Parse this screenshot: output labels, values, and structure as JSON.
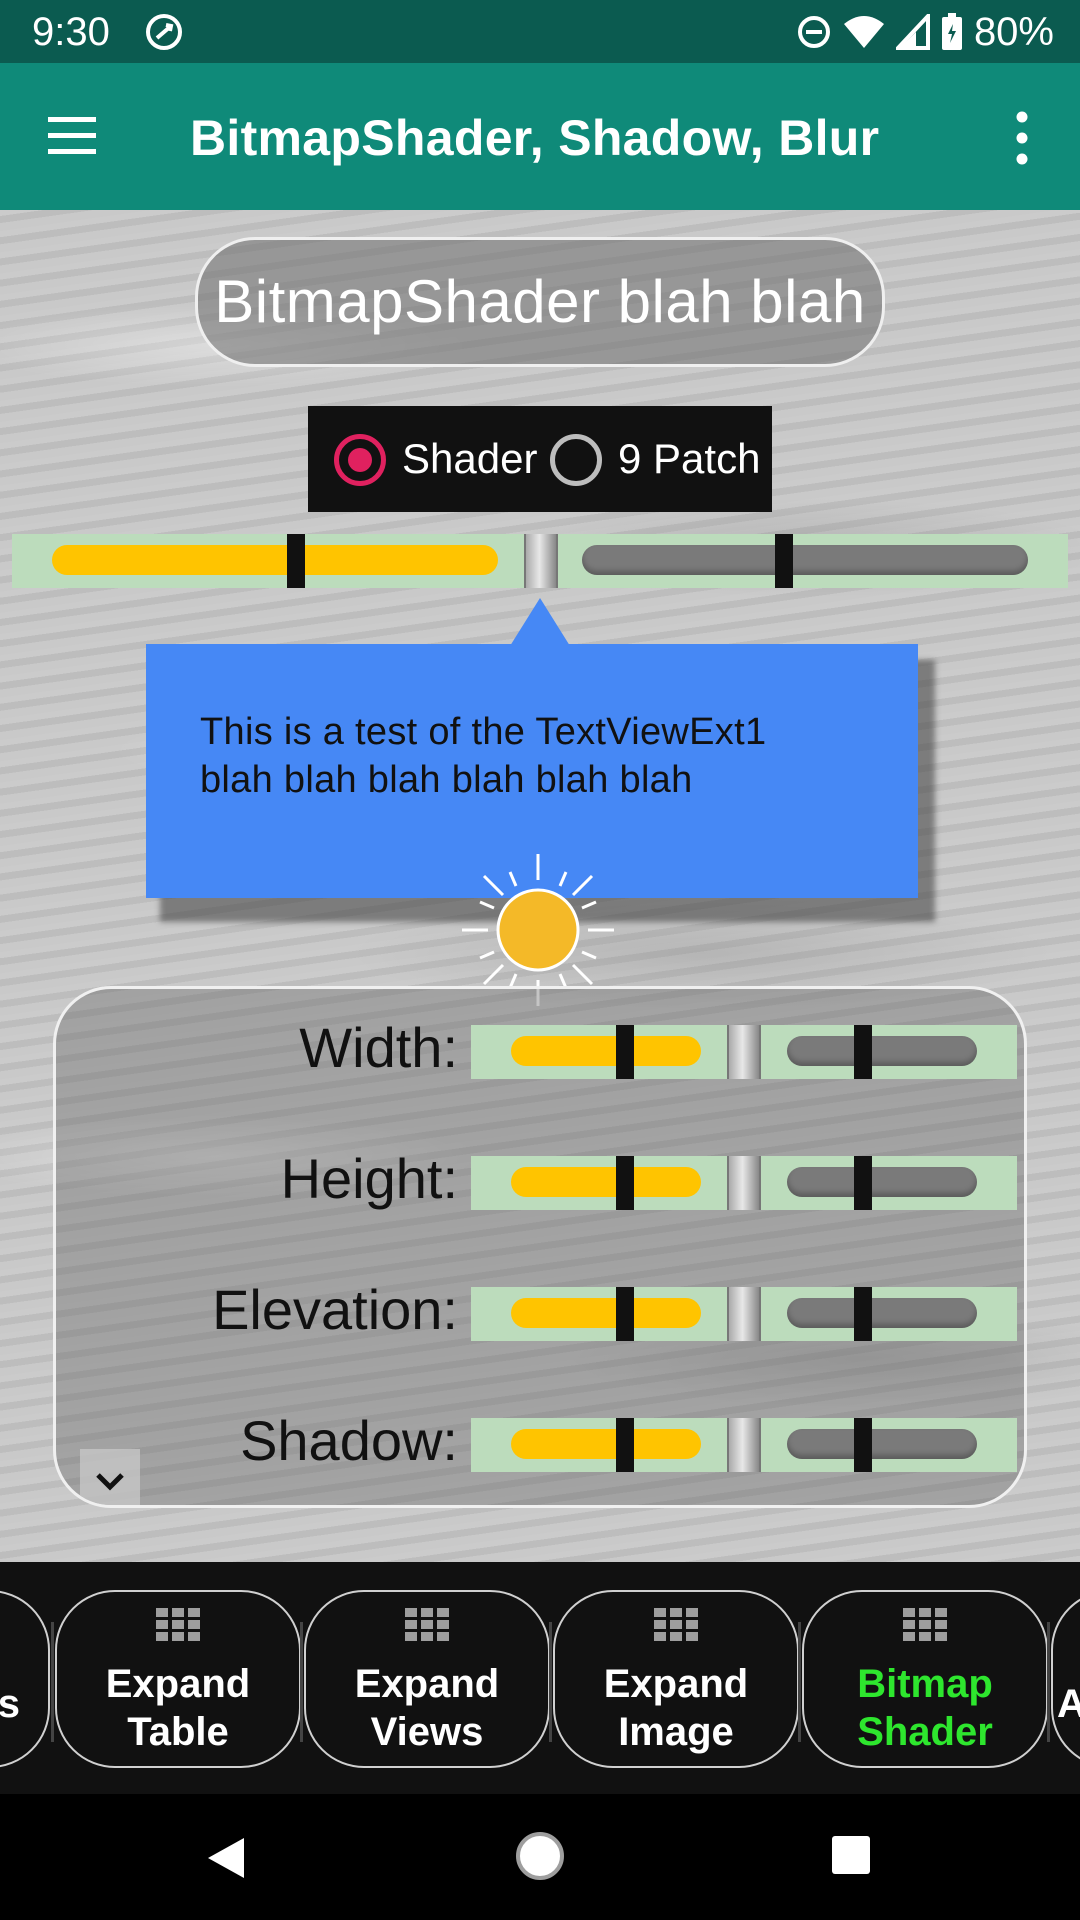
{
  "status_bar": {
    "time": "9:30",
    "battery_text": "80%"
  },
  "toolbar": {
    "title": "BitmapShader, Shadow, Blur"
  },
  "header_pill": {
    "text": "BitmapShader blah blah"
  },
  "radio_group": {
    "options": [
      {
        "label": "Shader",
        "selected": true
      },
      {
        "label": "9 Patch",
        "selected": false
      }
    ]
  },
  "main_slider": {
    "progress": 0.5
  },
  "callout": {
    "line1": "This is a test of the TextViewExt1",
    "line2": "blah blah blah blah blah blah"
  },
  "controls": {
    "rows": [
      {
        "label": "Width:",
        "progress": 0.5
      },
      {
        "label": "Height:",
        "progress": 0.5
      },
      {
        "label": "Elevation:",
        "progress": 0.5
      },
      {
        "label": "Shadow:",
        "progress": 0.5
      }
    ]
  },
  "tabs": {
    "left_partial": "s",
    "items": [
      {
        "line1": "Expand",
        "line2": "Table",
        "active": false
      },
      {
        "line1": "Expand",
        "line2": "Views",
        "active": false
      },
      {
        "line1": "Expand",
        "line2": "Image",
        "active": false
      },
      {
        "line1": "Bitmap",
        "line2": "Shader",
        "active": true
      }
    ],
    "right_partial": "A"
  },
  "colors": {
    "status_bar": "#0b5b50",
    "toolbar": "#0f8a79",
    "radio_accent": "#e0215f",
    "slider_fill": "#ffc400",
    "callout": "#4688f5",
    "active_tab": "#2ee62e"
  },
  "icons": [
    "sync-icon",
    "dnd-icon",
    "wifi-icon",
    "signal-icon",
    "battery-icon",
    "menu-icon",
    "overflow-icon",
    "sun-icon",
    "chevron-down-icon",
    "grid-icon",
    "back-icon",
    "home-icon",
    "recents-icon"
  ]
}
